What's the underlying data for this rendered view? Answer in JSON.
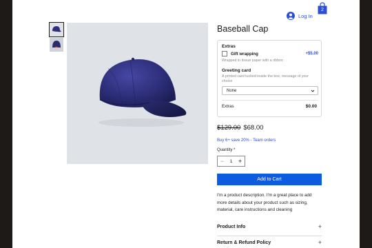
{
  "header": {
    "login_label": "Log In",
    "cart_count": "2"
  },
  "product": {
    "title": "Baseball Cap",
    "extras": {
      "title": "Extras",
      "gift_label": "Gift wrapping",
      "gift_price": "+$5.00",
      "gift_desc": "Wrapped in tissue paper with a ribbon",
      "card_title": "Greeting card",
      "card_desc": "A printed card tucked inside the box, message of your choice",
      "card_select_value": "None",
      "total_label": "Extras",
      "total_value": "$0.00"
    },
    "old_price": "$129.00",
    "new_price": "$68.00",
    "bulk_offer": "Buy 6+ save 20% - Team orders",
    "quantity_label": "Quantity *",
    "quantity_value": "1",
    "add_to_cart_label": "Add to Cart",
    "description": "I'm a product description. I'm a great place to add more details about your product such as sizing, material, care instructions and cleaning",
    "accordion": [
      {
        "label": "Product Info"
      },
      {
        "label": "Return & Refund Policy"
      }
    ]
  },
  "colors": {
    "accent_blue": "#0d5ce0",
    "link_blue": "#2d4fd4",
    "cap_navy": "#2e2f7a"
  },
  "icons": [
    "user-icon",
    "shopping-bag-icon",
    "chevron-down-icon",
    "minus-icon",
    "plus-icon"
  ]
}
